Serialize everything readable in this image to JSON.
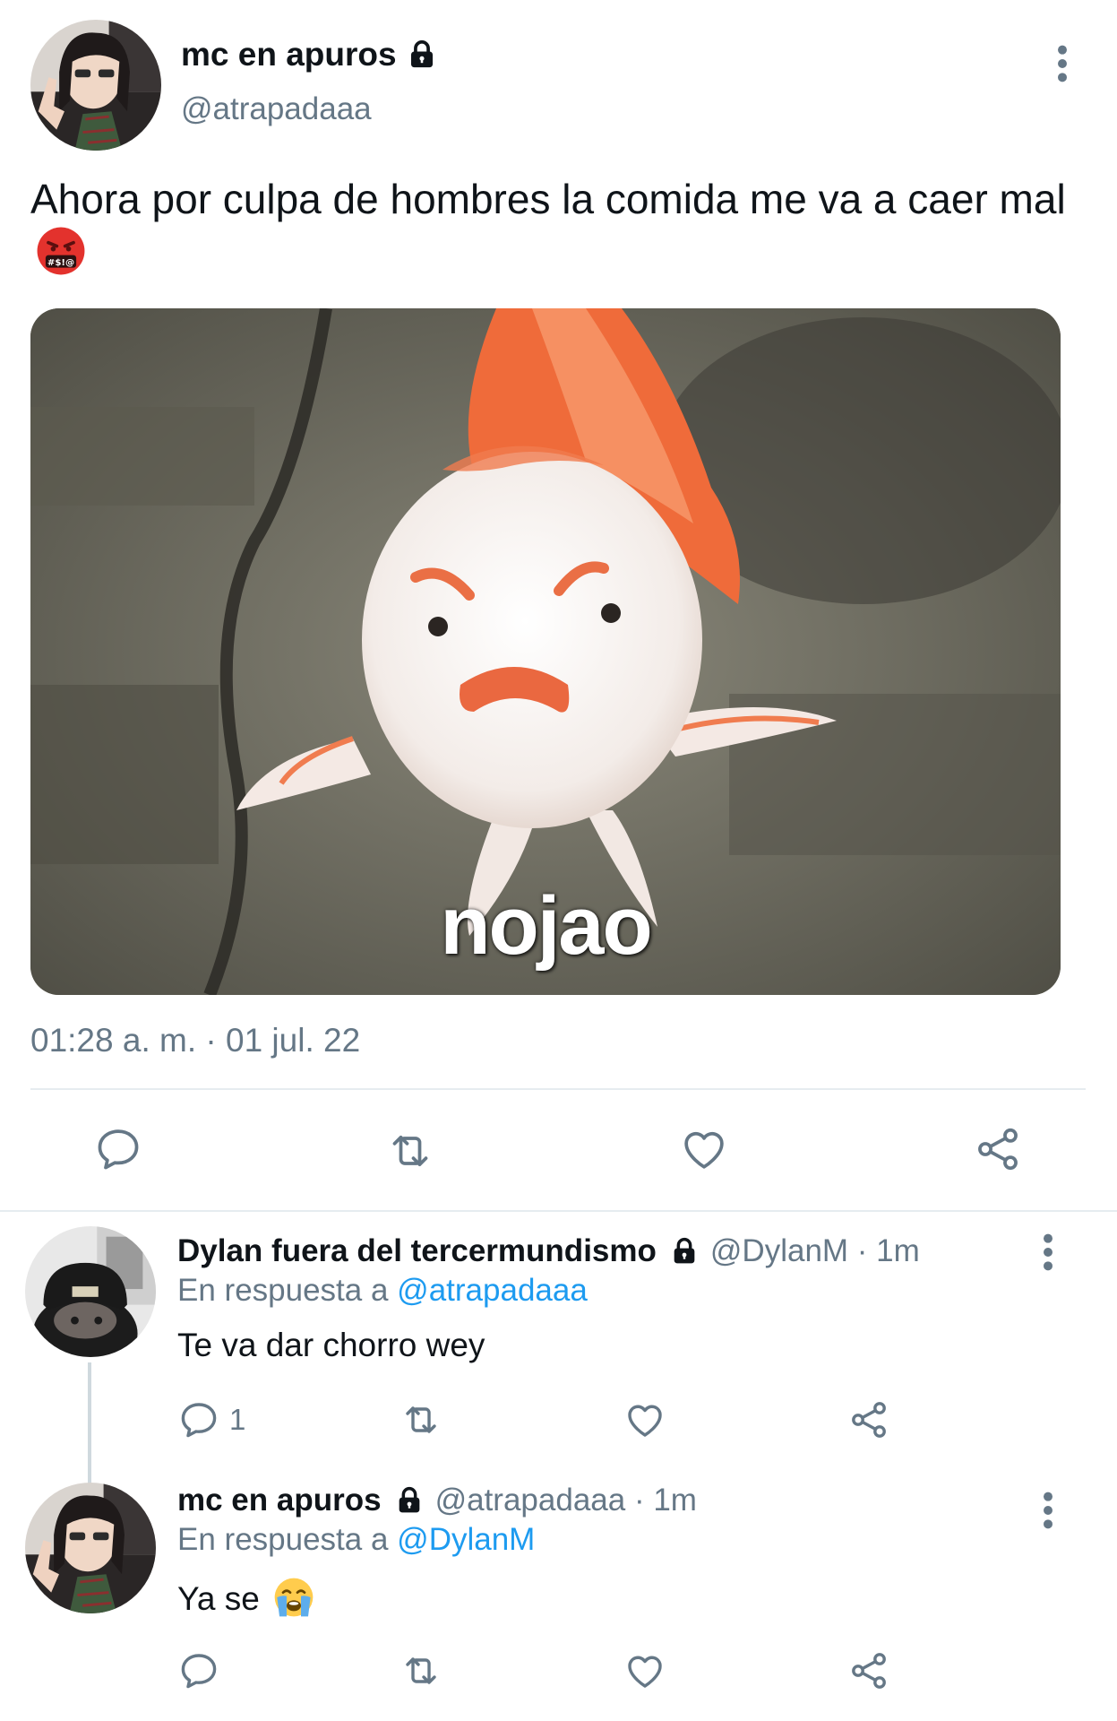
{
  "main_tweet": {
    "display_name": "mc en apuros",
    "handle": "@atrapadaaa",
    "text": "Ahora por culpa de hombres la comida me va a caer mal",
    "text_emoji": "face-with-symbols-on-mouth",
    "media_caption": "nojao",
    "timestamp": "01:28 a. m. · 01 jul. 22",
    "icons": {
      "reply": "reply-icon",
      "retweet": "retweet-icon",
      "like": "heart-icon",
      "share": "share-icon",
      "more": "more-vertical-icon",
      "protected": "lock-icon"
    }
  },
  "replies": [
    {
      "display_name": "Dylan fuera del tercermundismo",
      "handle": "@DylanM",
      "time": "1m",
      "in_reply_prefix": "En respuesta a",
      "in_reply_to": "@atrapadaaa",
      "text": "Te va dar chorro wey",
      "reply_count": "1"
    },
    {
      "display_name": "mc en apuros",
      "handle": "@atrapadaaa",
      "time": "1m",
      "in_reply_prefix": "En respuesta a",
      "in_reply_to": "@DylanM",
      "text": "Ya se",
      "text_emoji": "loudly-crying-face",
      "reply_count": ""
    }
  ],
  "colors": {
    "text_primary": "#0f1419",
    "text_secondary": "#657786",
    "link": "#1d9bf0",
    "divider": "#e6ecf0"
  }
}
